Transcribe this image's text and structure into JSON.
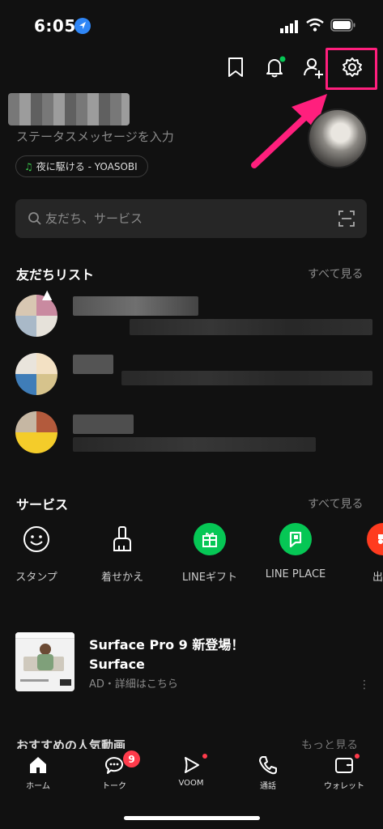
{
  "status_bar": {
    "time": "6:05"
  },
  "profile": {
    "status_placeholder": "ステータスメッセージを入力",
    "music": "夜に駆ける - YOASOBI"
  },
  "search": {
    "placeholder": "友だち、サービス"
  },
  "friends": {
    "title": "友だちリスト",
    "see_all": "すべて見る"
  },
  "services": {
    "title": "サービス",
    "see_all": "すべて見る",
    "items": [
      {
        "label": "スタンプ",
        "icon": "smiley-icon"
      },
      {
        "label": "着せかえ",
        "icon": "brush-icon"
      },
      {
        "label": "LINEギフト",
        "icon": "gift-icon",
        "color": "#06c755"
      },
      {
        "label": "LINE PLACE",
        "icon": "place-icon",
        "color": "#06c755"
      },
      {
        "label": "出前",
        "icon": "delivery-icon",
        "color": "#ff3b1f"
      }
    ]
  },
  "ad": {
    "title_line1": "Surface Pro 9 新登場！",
    "title_line2": "Surface",
    "subtitle": "AD・詳細はこちら",
    "more": "⋮"
  },
  "partial_section": {
    "title": "おすすめの人気動画",
    "more": "もっと見る"
  },
  "tabs": [
    {
      "label": "ホーム",
      "icon": "home-icon"
    },
    {
      "label": "トーク",
      "icon": "chat-icon",
      "badge": "9"
    },
    {
      "label": "VOOM",
      "icon": "voom-icon"
    },
    {
      "label": "通話",
      "icon": "phone-icon"
    },
    {
      "label": "ウォレット",
      "icon": "wallet-icon"
    }
  ],
  "colors": {
    "accent_highlight": "#ff1f7d",
    "line_green": "#06c755",
    "badge_red": "#ff3b4b"
  }
}
